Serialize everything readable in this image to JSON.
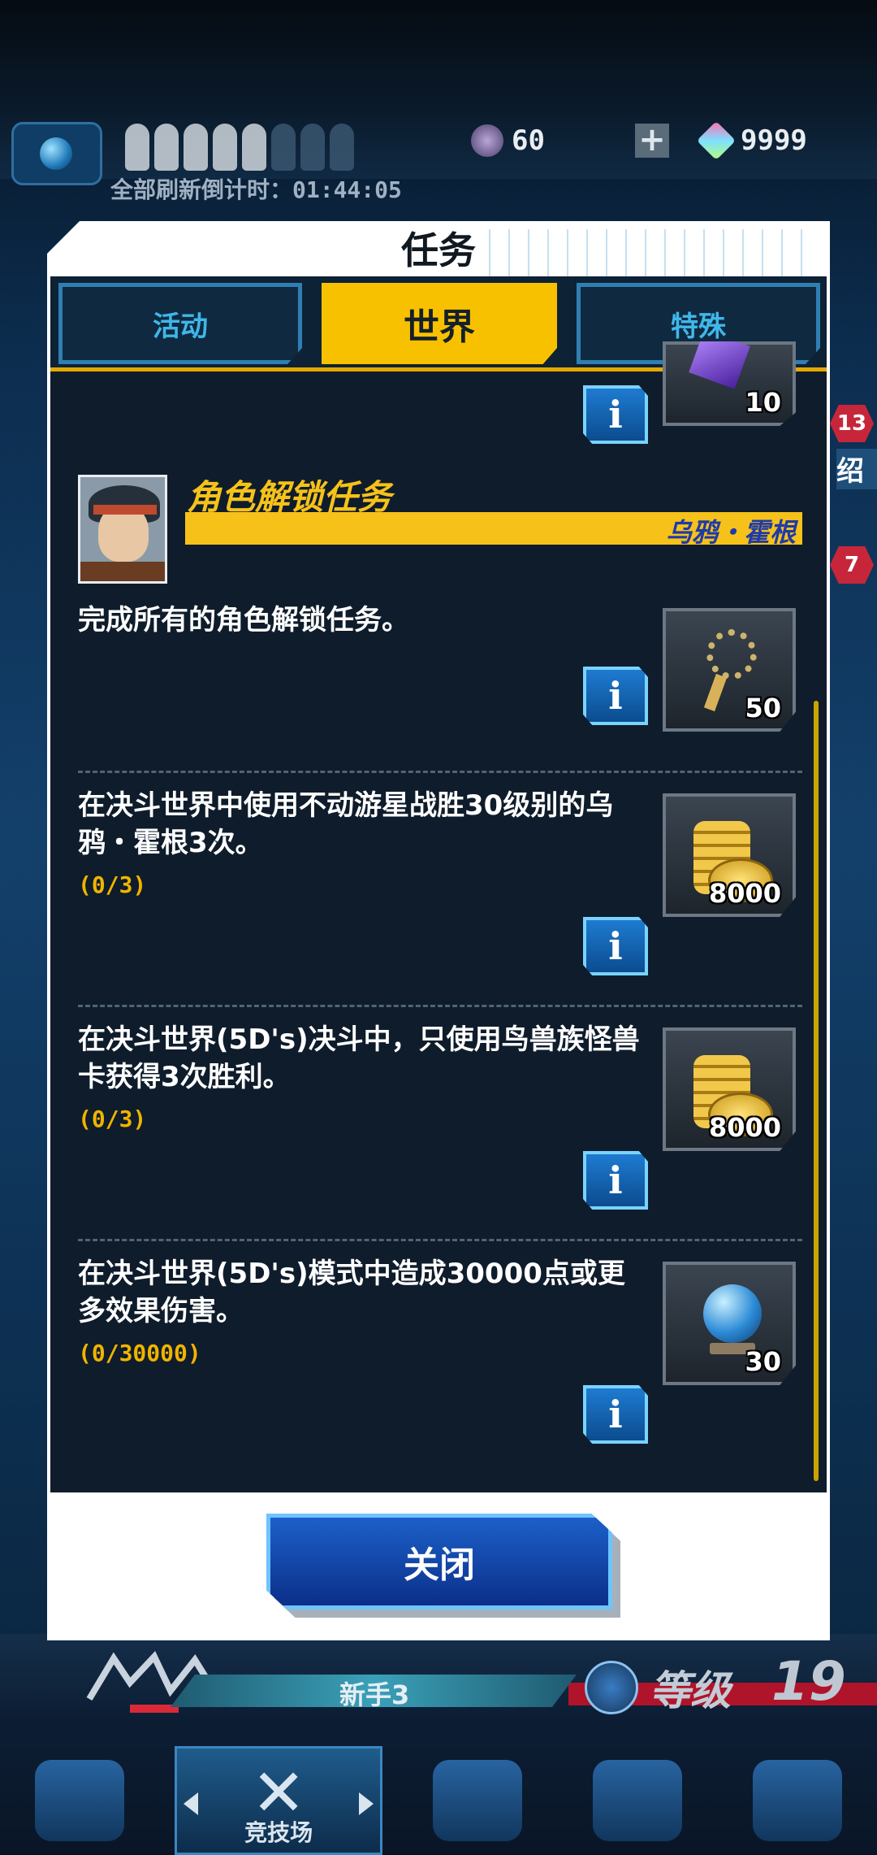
{
  "hud": {
    "currency_orbs": "60",
    "currency_gems": "9999",
    "plus_label": "+",
    "refresh_countdown": "全部刷新倒计时：01:44:05",
    "side_badge_1": "13",
    "side_badge_2": "7",
    "side_text": "绍"
  },
  "dialog": {
    "title": "任务",
    "tabs": [
      {
        "label": "活动",
        "active": false
      },
      {
        "label": "世界",
        "active": true
      },
      {
        "label": "特殊",
        "active": false
      }
    ],
    "top_reward_qty": "10",
    "group": {
      "title": "角色解锁任务",
      "character": "乌鸦・霍根"
    },
    "tasks": [
      {
        "text": "完成所有的角色解锁任务。",
        "progress": "",
        "reward_icon": "key-icon",
        "reward_qty": "50"
      },
      {
        "text": "在决斗世界中使用不动游星战胜30级别的乌鸦・霍根3次。",
        "progress": "(0/3)",
        "reward_icon": "gold-coins-icon",
        "reward_qty": "8000"
      },
      {
        "text": "在决斗世界(5D's)决斗中，只使用鸟兽族怪兽卡获得3次胜利。",
        "progress": "(0/3)",
        "reward_icon": "gold-coins-icon",
        "reward_qty": "8000"
      },
      {
        "text": "在决斗世界(5D's)模式中造成30000点或更多效果伤害。",
        "progress": "(0/30000)",
        "reward_icon": "rare-orb-icon",
        "reward_qty": "30"
      }
    ],
    "info_label": "i",
    "close_label": "关闭"
  },
  "footer": {
    "rank": "新手3",
    "level_label": "等级",
    "level_value": "19",
    "nav": [
      {
        "label": "",
        "icon": "profile-gear-icon"
      },
      {
        "label": "竞技场",
        "icon": "crossed-swords-icon"
      },
      {
        "label": "",
        "icon": "cart-icon"
      },
      {
        "label": "",
        "icon": "cards-icon"
      },
      {
        "label": "",
        "icon": "emblem-icon"
      }
    ]
  },
  "colors": {
    "accent_yellow": "#f6c21a",
    "tab_blue": "#3fb7ea",
    "panel_dark": "#0f1c2b",
    "progress_orange": "#f0b400",
    "button_blue": "#1c60c8"
  }
}
